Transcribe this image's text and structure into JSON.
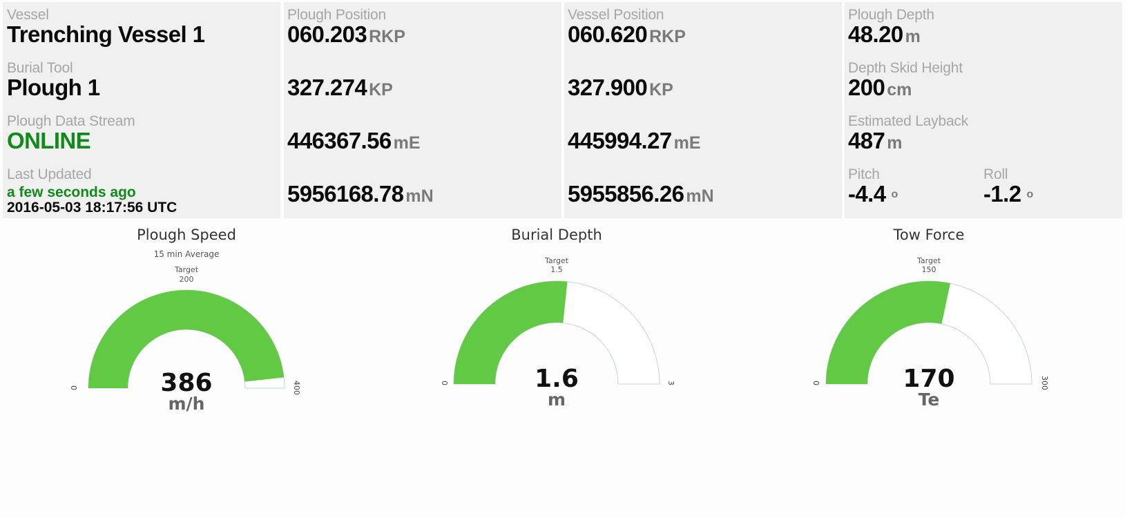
{
  "vessel_panel": {
    "vessel_label": "Vessel",
    "vessel_value": "Trenching Vessel 1",
    "tool_label": "Burial Tool",
    "tool_value": "Plough 1",
    "stream_label": "Plough Data Stream",
    "stream_value": "ONLINE",
    "updated_label": "Last Updated",
    "updated_relative": "a few seconds ago",
    "updated_timestamp": "2016-05-03 18:17:56 UTC"
  },
  "plough_position": {
    "label": "Plough Position",
    "rows": [
      {
        "value": "060.203",
        "unit": "RKP"
      },
      {
        "value": "327.274",
        "unit": "KP"
      },
      {
        "value": "446367.56",
        "unit": "mE"
      },
      {
        "value": "5956168.78",
        "unit": "mN"
      }
    ]
  },
  "vessel_position": {
    "label": "Vessel Position",
    "rows": [
      {
        "value": "060.620",
        "unit": "RKP"
      },
      {
        "value": "327.900",
        "unit": "KP"
      },
      {
        "value": "445994.27",
        "unit": "mE"
      },
      {
        "value": "5955856.26",
        "unit": "mN"
      }
    ]
  },
  "plough_stats": {
    "depth_label": "Plough Depth",
    "depth_value": "48.20",
    "depth_unit": "m",
    "skid_label": "Depth Skid Height",
    "skid_value": "200",
    "skid_unit": "cm",
    "layback_label": "Estimated Layback",
    "layback_value": "487",
    "layback_unit": "m",
    "pitch_label": "Pitch",
    "pitch_value": "-4.4",
    "roll_label": "Roll",
    "roll_value": "-1.2",
    "degree_symbol": "o"
  },
  "gauges": [
    {
      "title": "Plough Speed",
      "subtitle": "15 min Average",
      "target_label": "Target",
      "target": 200,
      "value": 386,
      "value_text": "386",
      "unit": "m/h",
      "min": 0,
      "max": 400,
      "min_text": "0",
      "max_text": "400"
    },
    {
      "title": "Burial Depth",
      "subtitle": "",
      "target_label": "Target",
      "target": 1.5,
      "value": 1.6,
      "value_text": "1.6",
      "unit": "m",
      "min": 0,
      "max": 3,
      "min_text": "0",
      "max_text": "3"
    },
    {
      "title": "Tow Force",
      "subtitle": "",
      "target_label": "Target",
      "target": 150,
      "value": 170,
      "value_text": "170",
      "unit": "Te",
      "min": 0,
      "max": 300,
      "min_text": "0",
      "max_text": "300"
    }
  ],
  "colors": {
    "gauge_fill": "#62c944",
    "gauge_track_stroke": "#c8d2dc",
    "online_green": "#108a1a"
  }
}
